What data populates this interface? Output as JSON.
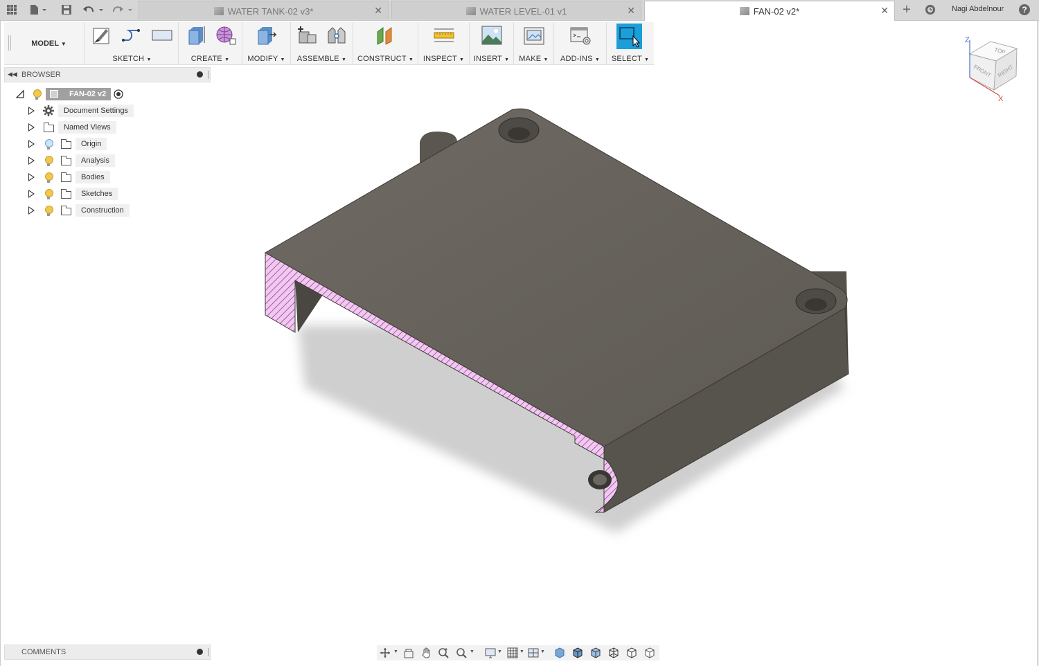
{
  "tabs": [
    {
      "label": "WATER TANK-02 v3*",
      "active": false
    },
    {
      "label": "WATER LEVEL-01 v1",
      "active": false
    },
    {
      "label": "FAN-02 v2*",
      "active": true
    }
  ],
  "user": {
    "name": "Nagi Abdelnour"
  },
  "workspace": {
    "label": "MODEL"
  },
  "toolbar_groups": [
    {
      "label": "SKETCH"
    },
    {
      "label": "CREATE"
    },
    {
      "label": "MODIFY"
    },
    {
      "label": "ASSEMBLE"
    },
    {
      "label": "CONSTRUCT"
    },
    {
      "label": "INSPECT"
    },
    {
      "label": "INSERT"
    },
    {
      "label": "MAKE"
    },
    {
      "label": "ADD-INS"
    },
    {
      "label": "SELECT"
    }
  ],
  "browser": {
    "title": "BROWSER",
    "root": "FAN-02 v2",
    "items": [
      {
        "label": "Document Settings"
      },
      {
        "label": "Named Views"
      },
      {
        "label": "Origin"
      },
      {
        "label": "Analysis"
      },
      {
        "label": "Bodies"
      },
      {
        "label": "Sketches"
      },
      {
        "label": "Construction"
      }
    ]
  },
  "viewcube": {
    "top": "TOP",
    "front": "FRONT",
    "right": "RIGHT",
    "axis_z": "Z",
    "axis_x": "X"
  },
  "comments": {
    "label": "COMMENTS"
  },
  "colors": {
    "accent": "#1a9fd9",
    "body": "#6b665f",
    "section": "#e6a9e6"
  }
}
